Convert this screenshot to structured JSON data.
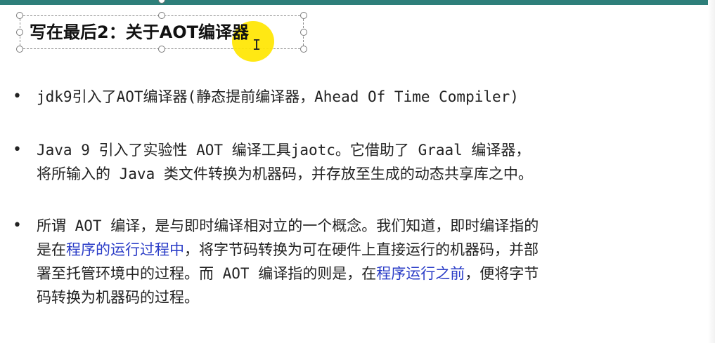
{
  "slide": {
    "title": "写在最后2：关于AOT编译器",
    "bullets": [
      {
        "lines": [
          [
            {
              "text": "jdk9引入了AOT编译器(静态提前编译器，Ahead Of Time Compiler)",
              "blue": false
            }
          ]
        ]
      },
      {
        "lines": [
          [
            {
              "text": "Java 9 引入了实验性 AOT 编译工具jaotc。它借助了 Graal 编译器，",
              "blue": false
            }
          ],
          [
            {
              "text": "将所输入的 Java 类文件转换为机器码，并存放至生成的动态共享库之中。",
              "blue": false
            }
          ]
        ]
      },
      {
        "lines": [
          [
            {
              "text": "所谓 AOT 编译，是与即时编译相对立的一个概念。我们知道，即时编译指的",
              "blue": false
            }
          ],
          [
            {
              "text": "是在",
              "blue": false
            },
            {
              "text": "程序的运行过程中",
              "blue": true
            },
            {
              "text": "，将字节码转换为可在硬件上直接运行的机器码，并部",
              "blue": false
            }
          ],
          [
            {
              "text": "署至托管环境中的过程。而 AOT 编译指的则是，在",
              "blue": false
            },
            {
              "text": "程序运行之前",
              "blue": true
            },
            {
              "text": "，便将字节",
              "blue": false
            }
          ],
          [
            {
              "text": "码转换为机器码的过程。",
              "blue": false
            }
          ]
        ]
      }
    ]
  },
  "colors": {
    "accent_bar": "#2e7f7a",
    "highlight_text": "#2a3cc7",
    "cursor_highlight": "#ffe600"
  }
}
